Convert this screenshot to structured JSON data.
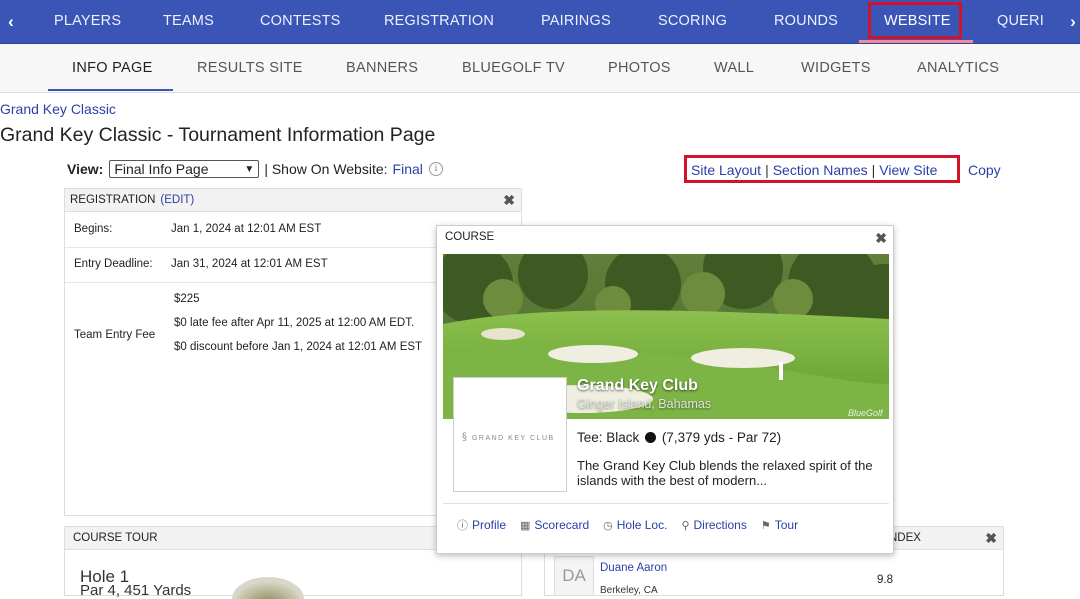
{
  "topnav": {
    "tabs": [
      "PLAYERS",
      "TEAMS",
      "CONTESTS",
      "REGISTRATION",
      "PAIRINGS",
      "SCORING",
      "ROUNDS",
      "WEBSITE",
      "QUERI"
    ],
    "active": "WEBSITE",
    "left_arrow": "‹",
    "right_arrow": "›"
  },
  "subnav": {
    "tabs": [
      "INFO PAGE",
      "RESULTS SITE",
      "BANNERS",
      "BLUEGOLF TV",
      "PHOTOS",
      "WALL",
      "WIDGETS",
      "ANALYTICS"
    ],
    "active": "INFO PAGE"
  },
  "breadcrumb": "Grand Key Classic",
  "page_title": "Grand Key Classic - Tournament Information Page",
  "view": {
    "label": "View:",
    "selected": "Final Info Page",
    "show_on_website_label": "| Show On Website:",
    "show_on_website_value": "Final"
  },
  "right_links": {
    "site_layout": "Site Layout",
    "section_names": "Section Names",
    "view_site": "View Site",
    "sep": "|",
    "copy": "Copy"
  },
  "registration": {
    "title": "REGISTRATION",
    "edit": "(EDIT)",
    "rows": [
      {
        "label": "Begins:",
        "value": "Jan 1, 2024 at 12:01 AM EST"
      },
      {
        "label": "Entry Deadline:",
        "value": "Jan 31, 2024 at 12:01 AM EST"
      }
    ],
    "fee_label": "Team Entry Fee",
    "fee_lines": [
      "$225",
      "$0 late fee after Apr 11, 2025 at 12:00 AM EDT.",
      "$0 discount before Jan 1, 2024 at 12:01 AM EST"
    ]
  },
  "course": {
    "title": "COURSE",
    "name": "Grand Key Club",
    "location": "Ginger Island, Bahamas",
    "logo_text": "GRAND KEY CLUB",
    "photo_credit": "BlueGolf",
    "tee_label": "Tee: Black",
    "tee_info": "(7,379 yds - Par 72)",
    "description": "The Grand Key Club blends the relaxed spirit of the islands with the best of modern...",
    "actions": [
      "Profile",
      "Scorecard",
      "Hole Loc.",
      "Directions",
      "Tour"
    ]
  },
  "course_tour": {
    "title": "COURSE TOUR",
    "hole": "Hole 1",
    "hole_info": "Par 4, 451 Yards"
  },
  "players": {
    "header_suffix": "NDEX",
    "initials": "DA",
    "name": "Duane Aaron",
    "location": "Berkeley, CA",
    "index": "9.8"
  }
}
